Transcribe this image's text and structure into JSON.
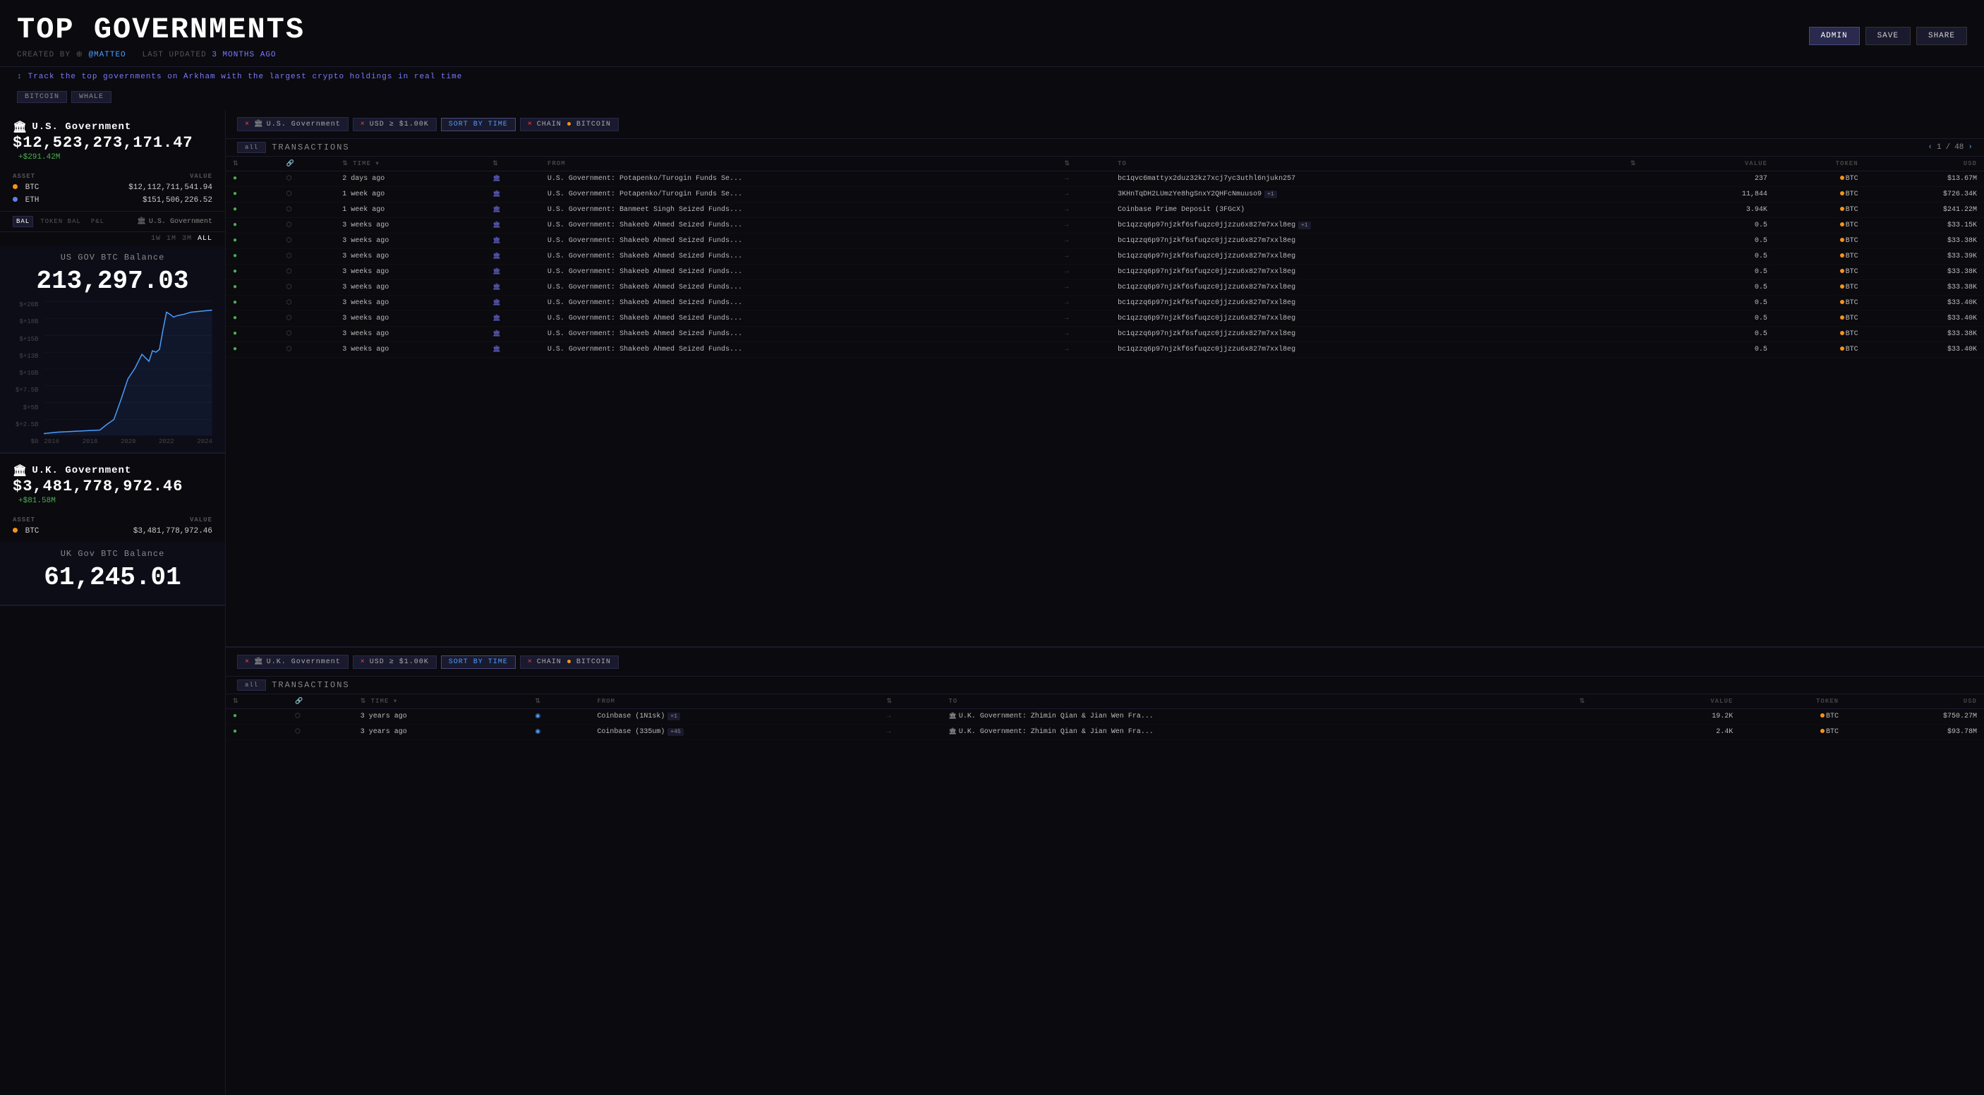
{
  "header": {
    "title": "TOP GOVERNMENTS",
    "meta": {
      "created_by": "CREATED BY",
      "author": "@MATTEO",
      "last_updated": "LAST UPDATED",
      "time_ago": "3 MONTHS AGO"
    },
    "buttons": {
      "admin": "ADMIN",
      "save": "SAVE",
      "share": "SHARE"
    }
  },
  "subtitle": "Track the top governments on Arkham with the largest crypto holdings in real time",
  "tags": [
    "BITCOIN",
    "WHALE"
  ],
  "us_gov": {
    "name": "U.S. Government",
    "icon": "🏛",
    "total_value": "$12,523,273,171.47",
    "change": "+$291.42M",
    "assets": [
      {
        "symbol": "BTC",
        "type": "btc",
        "value": "$12,112,711,541.94"
      },
      {
        "symbol": "ETH",
        "type": "eth",
        "value": "$151,506,226.52"
      }
    ],
    "chart": {
      "title": "US GOV BTC Balance",
      "value": "213,297.03",
      "time_ranges": [
        "1W",
        "1M",
        "3M",
        "ALL"
      ],
      "active_range": "ALL",
      "y_labels": [
        "$+20B",
        "$+18B",
        "$+15B",
        "$+13B",
        "$+10B",
        "$+7.5B",
        "$+5B",
        "$+2.5B",
        "$0"
      ],
      "x_labels": [
        "2016",
        "2018",
        "2020",
        "2022",
        "2024"
      ]
    },
    "bal_tabs": [
      "BAL",
      "TOKEN BAL",
      "P&L"
    ],
    "active_bal_tab": "BAL"
  },
  "uk_gov": {
    "name": "U.K. Government",
    "icon": "🏛",
    "total_value": "$3,481,778,972.46",
    "change": "+$81.58M",
    "assets": [
      {
        "symbol": "BTC",
        "type": "btc",
        "value": "$3,481,778,972.46"
      }
    ],
    "chart": {
      "title": "UK Gov BTC Balance",
      "value": "61,245.01"
    }
  },
  "us_transactions": {
    "filters": [
      {
        "type": "entity",
        "label": "U.S. Government",
        "icon": "🏛"
      },
      {
        "type": "value",
        "label": "USD ≥ $1.00K"
      },
      {
        "type": "sort",
        "label": "SORT BY TIME"
      },
      {
        "type": "chain",
        "label": "CHAIN",
        "chain": "BITCOIN"
      }
    ],
    "tab_all": "all",
    "title": "TRANSACTIONS",
    "pagination": {
      "current": 1,
      "total": 48
    },
    "columns": [
      "",
      "",
      "TIME",
      "",
      "FROM",
      "",
      "TO",
      "",
      "VALUE",
      "TOKEN",
      "USD"
    ],
    "rows": [
      {
        "time": "2 days ago",
        "from": "U.S. Government: Potapenko/Turogin Funds Se...",
        "to": "bc1qvc6mattyx2duz32kz7xcj7yc3uthl6njukn257",
        "badge": null,
        "value": "237",
        "token": "BTC",
        "usd": "$13.67M"
      },
      {
        "time": "1 week ago",
        "from": "U.S. Government: Potapenko/Turogin Funds Se...",
        "to": "3KHnTqDH2LUmzYe8hgSnxY2QHFcNmuuso9",
        "badge": "+1",
        "value": "11,844",
        "token": "BTC",
        "usd": "$726.34K"
      },
      {
        "time": "1 week ago",
        "from": "U.S. Government: Banmeet Singh Seized Funds...",
        "to": "Coinbase Prime Deposit (3FGcX)",
        "badge": null,
        "value": "3.94K",
        "token": "BTC",
        "usd": "$241.22M"
      },
      {
        "time": "3 weeks ago",
        "from": "U.S. Government: Shakeeb Ahmed Seized Funds...",
        "to": "bc1qzzq6p97njzkf6sfuqzc0jjzzu6x827m7xxl8eg",
        "badge": "+1",
        "value": "0.5",
        "token": "BTC",
        "usd": "$33.15K"
      },
      {
        "time": "3 weeks ago",
        "from": "U.S. Government: Shakeeb Ahmed Seized Funds...",
        "to": "bc1qzzq6p97njzkf6sfuqzc0jjzzu6x827m7xxl8eg",
        "badge": null,
        "value": "0.5",
        "token": "BTC",
        "usd": "$33.38K"
      },
      {
        "time": "3 weeks ago",
        "from": "U.S. Government: Shakeeb Ahmed Seized Funds...",
        "to": "bc1qzzq6p97njzkf6sfuqzc0jjzzu6x827m7xxl8eg",
        "badge": null,
        "value": "0.5",
        "token": "BTC",
        "usd": "$33.39K"
      },
      {
        "time": "3 weeks ago",
        "from": "U.S. Government: Shakeeb Ahmed Seized Funds...",
        "to": "bc1qzzq6p97njzkf6sfuqzc0jjzzu6x827m7xxl8eg",
        "badge": null,
        "value": "0.5",
        "token": "BTC",
        "usd": "$33.38K"
      },
      {
        "time": "3 weeks ago",
        "from": "U.S. Government: Shakeeb Ahmed Seized Funds...",
        "to": "bc1qzzq6p97njzkf6sfuqzc0jjzzu6x827m7xxl8eg",
        "badge": null,
        "value": "0.5",
        "token": "BTC",
        "usd": "$33.38K"
      },
      {
        "time": "3 weeks ago",
        "from": "U.S. Government: Shakeeb Ahmed Seized Funds...",
        "to": "bc1qzzq6p97njzkf6sfuqzc0jjzzu6x827m7xxl8eg",
        "badge": null,
        "value": "0.5",
        "token": "BTC",
        "usd": "$33.40K"
      },
      {
        "time": "3 weeks ago",
        "from": "U.S. Government: Shakeeb Ahmed Seized Funds...",
        "to": "bc1qzzq6p97njzkf6sfuqzc0jjzzu6x827m7xxl8eg",
        "badge": null,
        "value": "0.5",
        "token": "BTC",
        "usd": "$33.40K"
      },
      {
        "time": "3 weeks ago",
        "from": "U.S. Government: Shakeeb Ahmed Seized Funds...",
        "to": "bc1qzzq6p97njzkf6sfuqzc0jjzzu6x827m7xxl8eg",
        "badge": null,
        "value": "0.5",
        "token": "BTC",
        "usd": "$33.38K"
      },
      {
        "time": "3 weeks ago",
        "from": "U.S. Government: Shakeeb Ahmed Seized Funds...",
        "to": "bc1qzzq6p97njzkf6sfuqzc0jjzzu6x827m7xxl8eg",
        "badge": null,
        "value": "0.5",
        "token": "BTC",
        "usd": "$33.40K"
      }
    ]
  },
  "uk_transactions": {
    "filters": [
      {
        "type": "entity",
        "label": "U.K. Government",
        "icon": "🏛"
      },
      {
        "type": "value",
        "label": "USD ≥ $1.00K"
      },
      {
        "type": "sort",
        "label": "SORT BY TIME"
      },
      {
        "type": "chain",
        "label": "CHAIN",
        "chain": "BITCOIN"
      }
    ],
    "tab_all": "all",
    "title": "TRANSACTIONS",
    "columns": [
      "",
      "",
      "TIME",
      "",
      "FROM",
      "",
      "TO",
      "",
      "VALUE",
      "TOKEN",
      "USD"
    ],
    "rows": [
      {
        "time": "3 years ago",
        "from_type": "coinbase",
        "from": "Coinbase (1N1sk)",
        "from_badge": "+1",
        "to": "U.K. Government: Zhimin Qian & Jian Wen Fra...",
        "value": "19.2K",
        "token": "BTC",
        "usd": "$750.27M"
      },
      {
        "time": "3 years ago",
        "from_type": "coinbase",
        "from": "Coinbase (335um)",
        "from_badge": "+45",
        "to": "U.K. Government: Zhimin Qian & Jian Wen Fra...",
        "value": "2.4K",
        "token": "BTC",
        "usd": "$93.78M"
      }
    ]
  },
  "colors": {
    "btc": "#f7931a",
    "eth": "#627eea",
    "accent": "#4a9eff",
    "positive": "#4caf50",
    "negative": "#ff4444",
    "bg": "#0a0a0f",
    "card_bg": "#0d0d18",
    "border": "#1a1a2e"
  }
}
